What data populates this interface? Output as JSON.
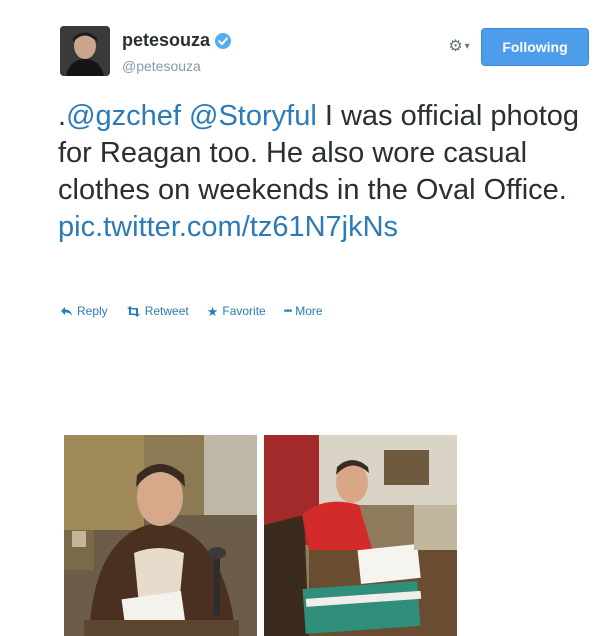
{
  "user": {
    "display_name": "petesouza",
    "handle": "@petesouza",
    "verified": true
  },
  "follow_button": {
    "label": "Following"
  },
  "tweet": {
    "prefix": ".",
    "mentions": [
      "@gzchef",
      "@Storyful"
    ],
    "body": " I was official photog for Reagan too. He also wore casual clothes on weekends in the Oval Office.",
    "link": "pic.twitter.com/tz61N7jkNs"
  },
  "actions": [
    {
      "label": "Reply",
      "icon": "reply-icon"
    },
    {
      "label": "Retweet",
      "icon": "retweet-icon"
    },
    {
      "label": "Favorite",
      "icon": "star-icon"
    },
    {
      "label": "More",
      "icon": "more-dots-icon"
    }
  ],
  "colors": {
    "link": "#2b7bb9",
    "follow_button": "#4d9dea",
    "verified": "#55acee",
    "muted": "#8899a6"
  }
}
